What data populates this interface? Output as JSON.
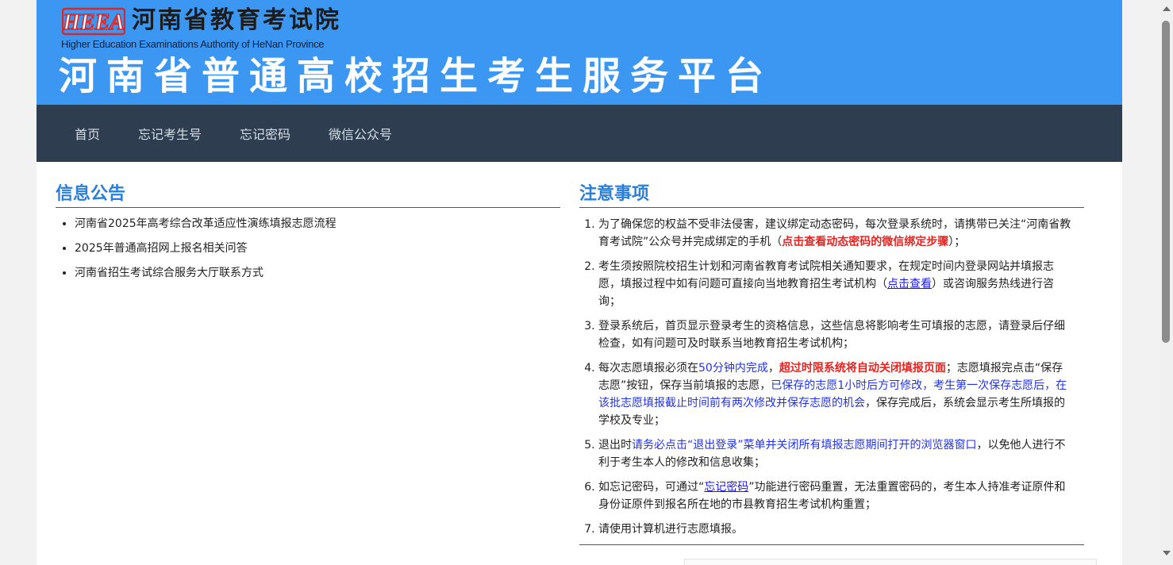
{
  "header": {
    "logo_text": "HEEA",
    "org_name_cn": "河南省教育考试院",
    "org_name_en": "Higher Education Examinations Authority of HeNan Province",
    "platform_title": "河南省普通高校招生考生服务平台"
  },
  "nav": {
    "items": [
      {
        "label": "首页"
      },
      {
        "label": "忘记考生号"
      },
      {
        "label": "忘记密码"
      },
      {
        "label": "微信公众号"
      }
    ]
  },
  "announcements": {
    "title": "信息公告",
    "items": [
      {
        "label": "河南省2025年高考综合改革适应性演练填报志愿流程"
      },
      {
        "label": "2025年普通高招网上报名相关问答"
      },
      {
        "label": "河南省招生考试综合服务大厅联系方式"
      }
    ]
  },
  "notes": {
    "title": "注意事项",
    "n1": {
      "a": "为了确保您的权益不受非法侵害，建议绑定动态密码，每次登录系统时，请携带已关注“河南省教育考试院”公众号并完成绑定的手机（",
      "red": "点击查看动态密码的微信绑定步骤",
      "b": "）；"
    },
    "n2": {
      "a": "考生须按照院校招生计划和河南省教育考试院相关通知要求，在规定时间内登录网站并填报志愿，填报过程中如有问题可直接向当地教育招生考试机构（",
      "link": "点击查看",
      "b": "）或咨询服务热线进行咨询；"
    },
    "n3": {
      "a": "登录系统后，首页显示登录考生的资格信息，这些信息将影响考生可填报的志愿，请登录后仔细检查，如有问题可及时联系当地教育招生考试机构；"
    },
    "n4": {
      "a": "每次志愿填报必须在",
      "blue1": "50分钟内完成",
      "b": "，",
      "red": "超过时限系统将自动关闭填报页面",
      "c": "；志愿填报完点击“保存志愿”按钮，保存当前填报的志愿，",
      "blue2": "已保存的志愿1小时后方可修改，考生第一次保存志愿后，在该批志愿填报截止时间前有两次修改并保存志愿的机会",
      "d": "，保存完成后，系统会显示考生所填报的学校及专业；"
    },
    "n5": {
      "a": "退出时",
      "blue": "请务必点击“退出登录”菜单并关闭所有填报志愿期间打开的浏览器窗口",
      "b": "，以免他人进行不利于考生本人的修改和信息收集；"
    },
    "n6": {
      "a": "如忘记密码，可通过“",
      "link": "忘记密码",
      "b": "”功能进行密码重置，无法重置密码的，考生本人持准考证原件和身份证原件到报名所在地的市县教育招生考试机构重置；"
    },
    "n7": {
      "a": "请使用计算机进行志愿填报。"
    }
  },
  "colors": {
    "banner": "#3b97f2",
    "nav_bg": "#2e3e50",
    "section_title": "#2a7fd9",
    "emphasis_red": "#e8231f",
    "emphasis_blue": "#2233dd"
  }
}
